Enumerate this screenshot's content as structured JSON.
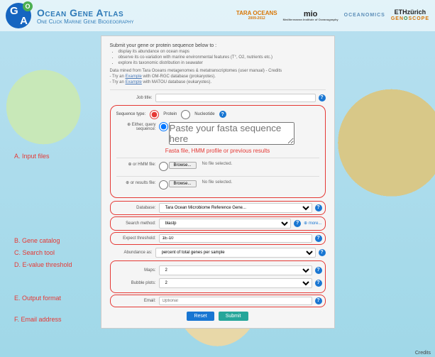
{
  "header": {
    "main_title": "Ocean Gene Atlas",
    "sub_title": "One Click Marine Gene Biogeography",
    "logos": {
      "tara": "TARA OCEANS",
      "tara_years": "2009-2012",
      "mio": "mio",
      "mio_sub": "Mediterranean Institute of Oceanography",
      "oceanomics": "OCEANOMICS",
      "eth": "ETHzürich",
      "genoscope": "GENOSCOPE"
    }
  },
  "intro": {
    "lead": "Submit your gene or protein sequence below to :",
    "bullets": [
      "display its abundance on ocean maps",
      "observe its co-variation with marine environmental features (T°, O2, nutrients etc.)",
      "explore its taxonomic distribution in seawater"
    ],
    "mined": "Data mined from Tara Oceans metagenomes & metatranscriptomes (user manual) - Credits",
    "try1_pre": "- Try an ",
    "try1_link": "Example",
    "try1_post": " with OM-RGC database (prokaryotes).",
    "try2_pre": "- Try an ",
    "try2_link": "Example",
    "try2_post": " with MATOU database (eukaryotes)."
  },
  "form": {
    "job_title_label": "Job title:",
    "sequence_type_label": "Sequence type:",
    "protein": "Protein",
    "nucleotide": "Nucleotide",
    "either_label": "⊕ Either, query sequence:",
    "fasta_placeholder": "Paste your fasta sequence here",
    "red_hint": "Fasta file, HMM profile or previous results",
    "hmm_label": "⊕ or HMM file:",
    "results_label": "⊕ or results file:",
    "browse": "Browse...",
    "no_file": "No file selected.",
    "database_label": "Database:",
    "database_value": "Tara Ocean Microbiome Reference Gene...",
    "search_label": "Search method:",
    "search_value": "blastp",
    "more": "⊕ more...",
    "expect_label": "Expect threshold:",
    "expect_value": "1E-10",
    "abundance_label": "Abundance as:",
    "abundance_value": "percent of total genes per sample",
    "maps_label": "Maps:",
    "maps_value": "2",
    "bubble_label": "Bubble plots:",
    "bubble_value": "2",
    "email_label": "Email:",
    "email_placeholder": "Optional",
    "reset": "Reset",
    "submit": "Submit"
  },
  "annotations": {
    "a": "A. Input files",
    "b": "B. Gene catalog",
    "c": "C. Search tool",
    "d": "D. E-value threshold",
    "e": "E. Output format",
    "f": "F. Email address"
  },
  "credits": "Credits"
}
